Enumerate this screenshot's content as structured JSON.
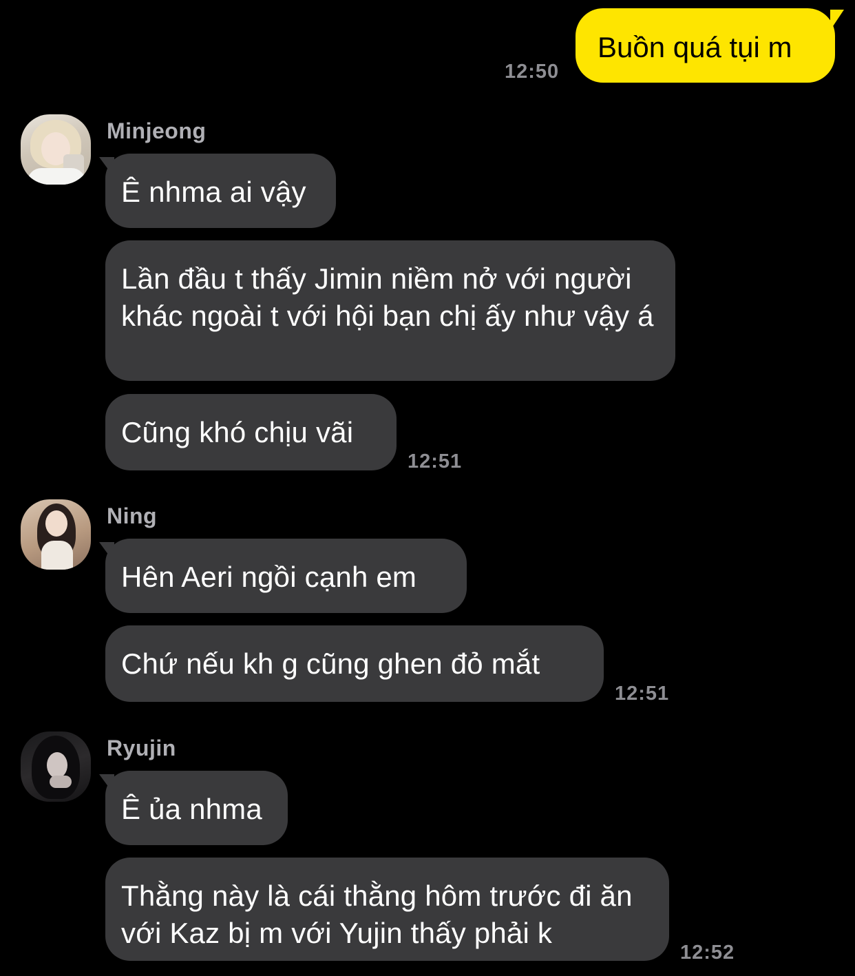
{
  "outgoing": {
    "text": "Buồn quá tụi m",
    "time": "12:50"
  },
  "groups": [
    {
      "sender": "Minjeong",
      "avatar_icon": "avatar-photo-minjeong",
      "messages": [
        "Ê nhma ai vậy",
        "Lần đầu t thấy Jimin niềm nở với người khác ngoài t với hội bạn chị ấy như vậy á",
        "Cũng khó chịu vãi"
      ],
      "time": "12:51"
    },
    {
      "sender": "Ning",
      "avatar_icon": "avatar-photo-ning",
      "messages": [
        "Hên Aeri ngồi cạnh em",
        "Chứ nếu kh g cũng ghen đỏ mắt"
      ],
      "time": "12:51"
    },
    {
      "sender": "Ryujin",
      "avatar_icon": "avatar-photo-ryujin",
      "messages": [
        "Ê ủa nhma",
        "Thằng này là cái thằng hôm trước đi ăn với Kaz bị m với Yujin thấy phải k"
      ],
      "time": "12:52"
    }
  ],
  "colors": {
    "background": "#000000",
    "outgoing_bubble": "#fee500",
    "incoming_bubble": "#3a3a3c",
    "timestamp": "#8e8e93",
    "sender_name": "#b0b0b5"
  }
}
